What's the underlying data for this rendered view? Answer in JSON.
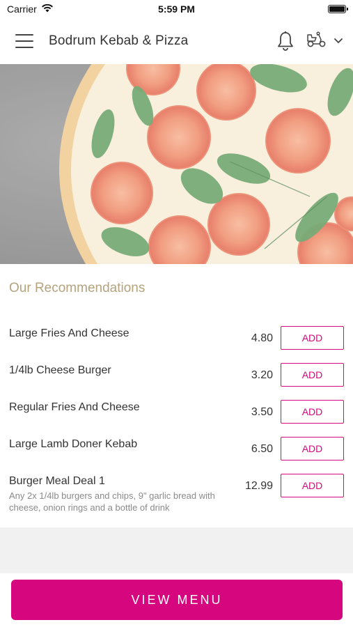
{
  "status_bar": {
    "carrier": "Carrier",
    "time": "5:59 PM"
  },
  "header": {
    "title": "Bodrum Kebab & Pizza",
    "icons": [
      "menu-icon",
      "bell-icon",
      "scooter-icon",
      "chevron-down-icon"
    ]
  },
  "hero": {
    "image": "pizza-with-tomato-and-basil"
  },
  "recommendations": {
    "title": "Our Recommendations",
    "add_label": "ADD",
    "items": [
      {
        "name": "Large Fries And Cheese",
        "price": "4.80",
        "description": ""
      },
      {
        "name": "1/4lb Cheese Burger",
        "price": "3.20",
        "description": ""
      },
      {
        "name": "Regular Fries And Cheese",
        "price": "3.50",
        "description": ""
      },
      {
        "name": "Large Lamb Doner Kebab",
        "price": "6.50",
        "description": ""
      },
      {
        "name": "Burger Meal Deal 1",
        "price": "12.99",
        "description": "Any 2x 1/4lb burgers and chips, 9\" garlic bread with cheese, onion rings and a bottle of drink"
      }
    ]
  },
  "footer": {
    "view_menu_label": "VIEW MENU"
  },
  "colors": {
    "accent": "#d6067f",
    "section_title": "#b5a37e",
    "description": "#8a8a8a"
  }
}
